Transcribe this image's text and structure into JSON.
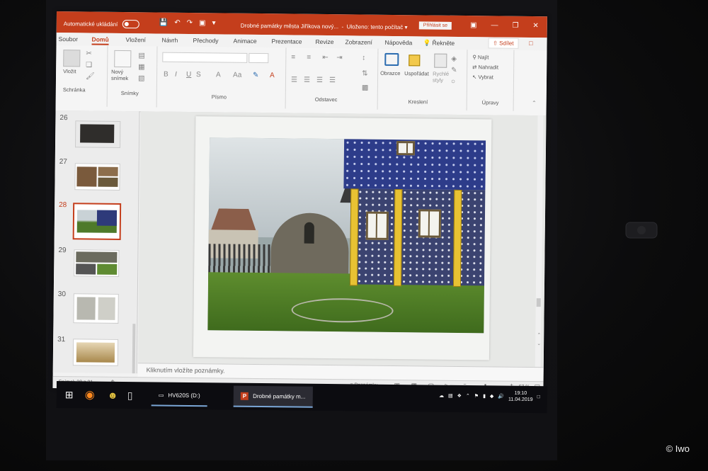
{
  "titlebar": {
    "autosave_label": "Automatické ukládání",
    "document_title": "Drobné památky města Jiříkova nový...",
    "saved_status": "Uloženo: tento počítač",
    "signin_label": "Přihlásit se",
    "accent_color": "#c43e1c"
  },
  "tabs": [
    "Soubor",
    "Domů",
    "Vložení",
    "Návrh",
    "Přechody",
    "Animace",
    "Prezentace",
    "Revize",
    "Zobrazení",
    "Nápověda",
    "Řekněte"
  ],
  "active_tab": "Domů",
  "share_label": "Sdílet",
  "ribbon": {
    "clipboard": {
      "label": "Schránka",
      "paste": "Vložit"
    },
    "slides": {
      "label": "Snímky",
      "new_slide": "Nový snímek"
    },
    "font": {
      "label": "Písmo",
      "buttons": [
        "B",
        "I",
        "U",
        "S",
        "A",
        "Aa",
        "A"
      ]
    },
    "paragraph": {
      "label": "Odstavec"
    },
    "drawing": {
      "label": "Kreslení",
      "shapes": "Obrazce",
      "arrange": "Uspořádat",
      "quick_styles": "Rychlé styly"
    },
    "editing": {
      "label": "Úpravy",
      "find": "Najít",
      "replace": "Nahradit",
      "select": "Vybrat"
    }
  },
  "thumbnails": [
    {
      "number": "26",
      "selected": false
    },
    {
      "number": "27",
      "selected": false
    },
    {
      "number": "28",
      "selected": true
    },
    {
      "number": "29",
      "selected": false
    },
    {
      "number": "30",
      "selected": false
    },
    {
      "number": "31",
      "selected": false
    }
  ],
  "notes_placeholder": "Kliknutím vložíte poznámky.",
  "status": {
    "slide_counter": "Snímek 28 z 31",
    "notes_button": "Poznámky",
    "zoom": "67 %"
  },
  "taskbar": {
    "drive_label": "HV620S (D:)",
    "ppt_label": "Drobné památky m...",
    "time": "19:10",
    "date": "11.04.2019"
  },
  "credit": "© Iwo"
}
